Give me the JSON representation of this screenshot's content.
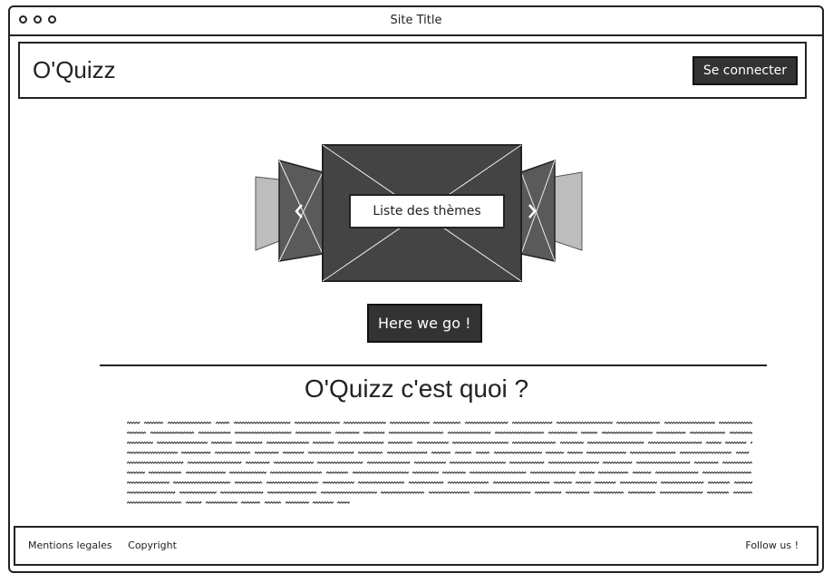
{
  "window": {
    "title": "Site Title"
  },
  "header": {
    "logo": "O'Quizz",
    "login_label": "Se connecter"
  },
  "carousel": {
    "caption": "Liste des thèmes",
    "prev_icon": "chevron-left-icon",
    "next_icon": "chevron-right-icon"
  },
  "hero": {
    "cta_label": "Here we go !"
  },
  "about": {
    "title": "O'Quizz c'est quoi ?"
  },
  "footer": {
    "legal": "Mentions legales",
    "copyright": "Copyright",
    "follow": "Follow us !"
  },
  "colors": {
    "dark": "#333333",
    "mid": "#555555",
    "light": "#bbbbbb",
    "border": "#222222"
  }
}
